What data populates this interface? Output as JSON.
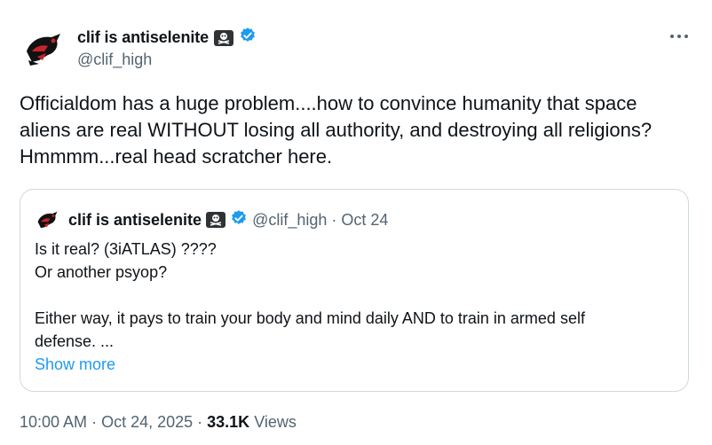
{
  "author": {
    "display_name": "clif is antiselenite",
    "handle": "@clif_high",
    "verified_icon": "verified-badge-icon",
    "avatar_icon": "raven-totem-avatar",
    "emoji_icon": "skull-crossbones-icon"
  },
  "tweet": {
    "text": "Officialdom has a huge problem....how to convince humanity that space\naliens are real WITHOUT losing all authority, and destroying all religions?\nHmmmm...real head scratcher here."
  },
  "quoted_tweet": {
    "display_name": "clif is antiselenite",
    "handle": "@clif_high",
    "separator": "·",
    "date": "Oct 24",
    "text": "Is it real? (3iATLAS) ????\nOr another psyop?\n\nEither way, it pays to train your body and mind daily AND to train in armed self\ndefense. ...",
    "show_more": "Show more"
  },
  "meta": {
    "time": "10:00 AM",
    "sep1": "·",
    "date": "Oct 24, 2025",
    "sep2": "·",
    "views_count": "33.1K",
    "views_label": "Views"
  },
  "colors": {
    "accent": "#1d9bf0",
    "text": "#0f1419",
    "secondary": "#536471",
    "border": "#cfd9de"
  }
}
